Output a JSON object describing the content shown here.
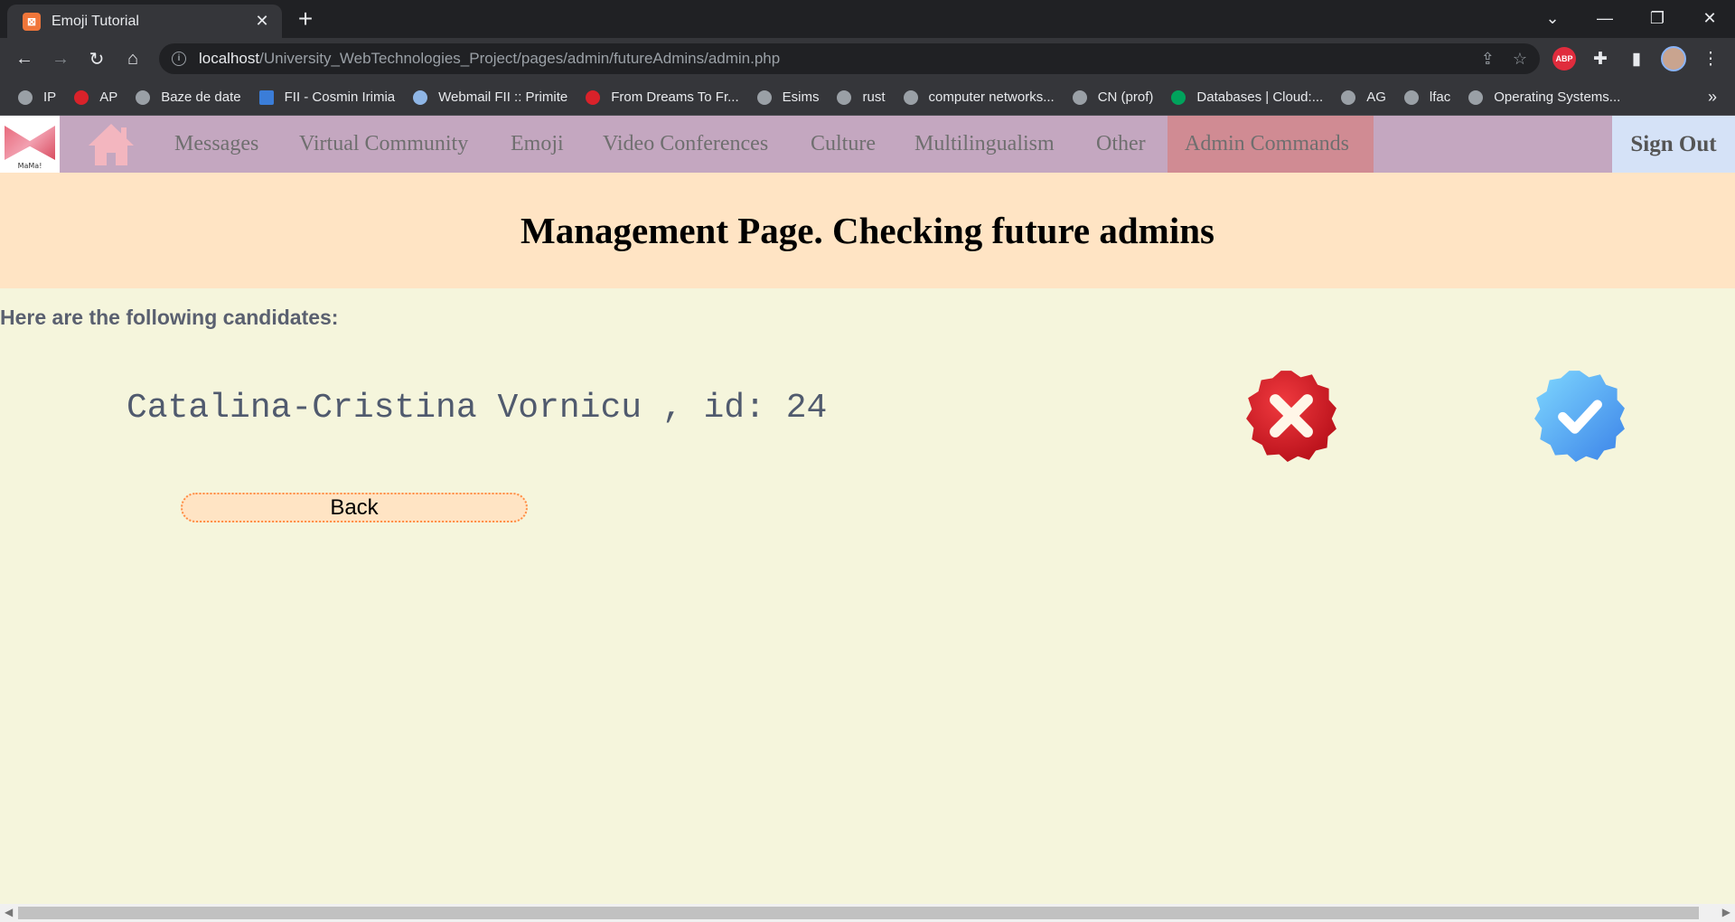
{
  "browser": {
    "tab_title": "Emoji Tutorial",
    "url_host": "localhost",
    "url_path": "/University_WebTechnologies_Project/pages/admin/futureAdmins/admin.php",
    "bookmarks": [
      "IP",
      "AP",
      "Baze de date",
      "FII - Cosmin Irimia",
      "Webmail FII :: Primite",
      "From Dreams To Fr...",
      "Esims",
      "rust",
      "computer networks...",
      "CN (prof)",
      "Databases | Cloud:...",
      "AG",
      "lfac",
      "Operating Systems..."
    ],
    "abp_label": "ABP"
  },
  "site": {
    "logo_text": "MaMa!",
    "nav": [
      "Messages",
      "Virtual Community",
      "Emoji",
      "Video Conferences",
      "Culture",
      "Multilingualism",
      "Other",
      "Admin Commands"
    ],
    "sign_out": "Sign Out"
  },
  "main": {
    "title": "Management Page. Checking future admins",
    "candidates_label": "Here are the following candidates:",
    "candidate": "Catalina-Cristina Vornicu , id: 24",
    "back_label": "Back"
  },
  "colors": {
    "nav_bg": "#c4a7c0",
    "nav_active": "#d08b93",
    "banner_bg": "#ffe4c4",
    "page_bg": "#f5f5dc",
    "reject_red": "#d7191f",
    "approve_blue": "#4fa3f0"
  }
}
